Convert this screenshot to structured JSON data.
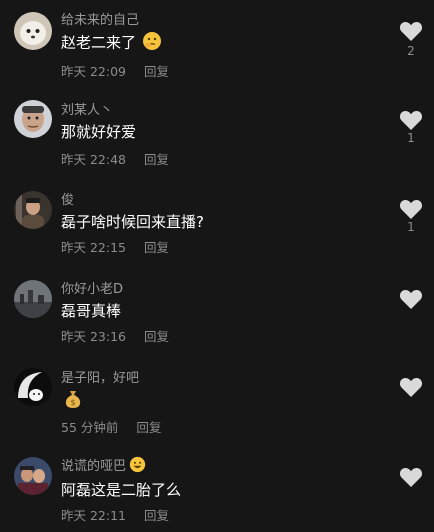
{
  "comments": [
    {
      "username": "给未来的自己",
      "text": "赵老二来了",
      "time": "昨天 22:09",
      "reply": "回复",
      "likes": "2",
      "emoji": "thinking-emoji"
    },
    {
      "username": "刘某人丶",
      "text": "那就好好爱",
      "time": "昨天 22:48",
      "reply": "回复",
      "likes": "1"
    },
    {
      "username": "俊",
      "text": "磊子啥时候回来直播?",
      "time": "昨天 22:15",
      "reply": "回复",
      "likes": "1"
    },
    {
      "username": "你好小老D",
      "text": "磊哥真棒",
      "time": "昨天 23:16",
      "reply": "回复",
      "likes": ""
    },
    {
      "username": "是子阳，好吧",
      "text": "",
      "time": "55 分钟前",
      "reply": "回复",
      "likes": "",
      "emoji": "money-bag-emoji"
    },
    {
      "username": "说谎的哑巴",
      "text": "阿磊这是二胎了么",
      "time": "昨天 22:11",
      "reply": "回复",
      "likes": "",
      "emoji": "grin-emoji"
    }
  ],
  "colors": {
    "background": "#161616",
    "heart": "#d9d9d9",
    "secondary_text": "#8c8c8c"
  }
}
